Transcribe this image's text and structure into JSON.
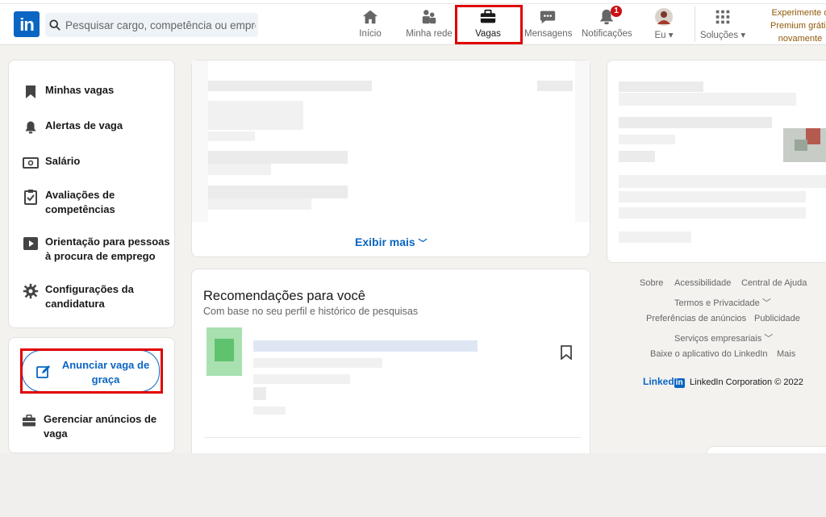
{
  "header": {
    "logo_text": "in",
    "search_placeholder": "Pesquisar cargo, competência ou empresa",
    "nav": [
      {
        "label": "Início",
        "icon": "home-icon"
      },
      {
        "label": "Minha rede",
        "icon": "network-icon"
      },
      {
        "label": "Vagas",
        "icon": "briefcase-icon",
        "active": true
      },
      {
        "label": "Mensagens",
        "icon": "messaging-icon"
      },
      {
        "label": "Notificações",
        "icon": "bell-icon",
        "badge": "1"
      },
      {
        "label": "Eu",
        "icon": "avatar"
      },
      {
        "label": "Soluções",
        "icon": "grid-icon"
      }
    ],
    "premium_line1": "Experimente o",
    "premium_line2": "Premium grátis",
    "premium_line3": "novamente"
  },
  "sidebar": {
    "items": [
      {
        "label": "Minhas vagas",
        "icon": "bookmark-icon"
      },
      {
        "label": "Alertas de vaga",
        "icon": "bell-icon"
      },
      {
        "label": "Salário",
        "icon": "money-icon"
      },
      {
        "label": "Avaliações de competências",
        "icon": "clipboard-check-icon"
      },
      {
        "label": "Orientação para pessoas à procura de emprego",
        "icon": "play-video-icon"
      },
      {
        "label": "Configurações da candidatura",
        "icon": "gear-icon"
      }
    ],
    "post_job_label": "Anunciar vaga de graça",
    "manage_jobs_label": "Gerenciar anúncios de vaga"
  },
  "main": {
    "show_more": "Exibir mais",
    "recommendations_title": "Recomendações para você",
    "recommendations_subtitle": "Com base no seu perfil e histórico de pesquisas"
  },
  "footer": {
    "links": [
      "Sobre",
      "Acessibilidade",
      "Central de Ajuda",
      "Termos e Privacidade",
      "Preferências de anúncios",
      "Publicidade",
      "Serviços empresariais",
      "Baixe o aplicativo do LinkedIn",
      "Mais"
    ],
    "brand": "Linked",
    "brand_in": "in",
    "copyright": "LinkedIn Corporation © 2022"
  },
  "colors": {
    "accent": "#0a66c2",
    "highlight": "#e00000",
    "premium": "#915907"
  }
}
